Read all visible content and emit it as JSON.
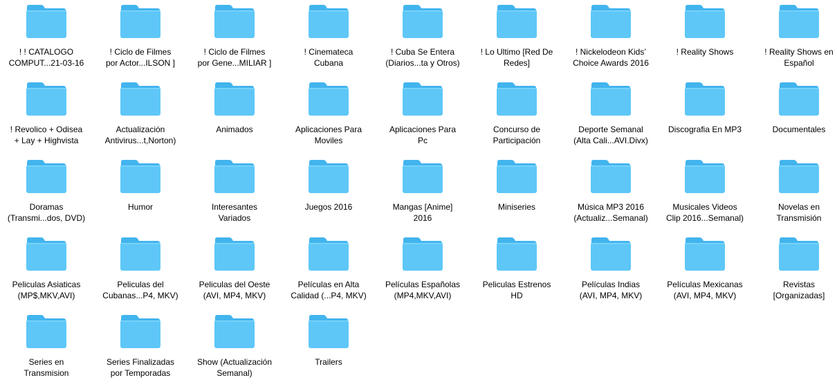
{
  "colors": {
    "folder_body": "#5ec7f7",
    "folder_back": "#42b4ee",
    "folder_highlight": "#7fd6fb",
    "label_text": "#000000",
    "background": "#ffffff"
  },
  "icon": "folder-icon",
  "folders": [
    {
      "label": "! ! CATALOGO\nCOMPUT...21-03-16"
    },
    {
      "label": "! Ciclo de Filmes\npor Actor...ILSON ]"
    },
    {
      "label": "! Ciclo de Filmes\npor Gene...MILIAR ]"
    },
    {
      "label": "! Cinemateca\nCubana"
    },
    {
      "label": "! Cuba Se Entera\n(Diarios...ta y Otros)"
    },
    {
      "label": "! Lo Ultimo [Red De\nRedes]"
    },
    {
      "label": "! Nickelodeon Kids’\nChoice Awards 2016"
    },
    {
      "label": "! Reality Shows"
    },
    {
      "label": "! Reality Shows en\nEspañol"
    },
    {
      "label": "! Revolico + Odisea\n+ Lay + Highvista"
    },
    {
      "label": "Actualización\nAntivirus...t,Norton)"
    },
    {
      "label": "Animados"
    },
    {
      "label": "Aplicaciones Para\nMoviles"
    },
    {
      "label": "Aplicaciones Para\nPc"
    },
    {
      "label": "Concurso de\nParticipación"
    },
    {
      "label": "Deporte Semanal\n(Alta Cali...AVI.Divx)"
    },
    {
      "label": "Discografia En MP3"
    },
    {
      "label": "Documentales"
    },
    {
      "label": "Doramas\n(Transmi...dos, DVD)"
    },
    {
      "label": "Humor"
    },
    {
      "label": "Interesantes\nVariados"
    },
    {
      "label": "Juegos 2016"
    },
    {
      "label": "Mangas [Anime]\n2016"
    },
    {
      "label": "Miniseries"
    },
    {
      "label": "Música MP3 2016\n(Actualiz...Semanal)"
    },
    {
      "label": "Musicales Videos\nClip 2016...Semanal)"
    },
    {
      "label": "Novelas en\nTransmisión"
    },
    {
      "label": "Peliculas Asiaticas\n(MP$,MKV,AVI)"
    },
    {
      "label": "Peliculas del\nCubanas...P4, MKV)"
    },
    {
      "label": "Peliculas del Oeste\n(AVI, MP4, MKV)"
    },
    {
      "label": "Películas en Alta\nCalidad (...P4, MKV)"
    },
    {
      "label": "Películas Españolas\n(MP4,MKV,AVI)"
    },
    {
      "label": "Peliculas Estrenos\nHD"
    },
    {
      "label": "Películas Indias\n(AVI, MP4, MKV)"
    },
    {
      "label": "Películas Mexicanas\n(AVI, MP4, MKV)"
    },
    {
      "label": "Revistas\n[Organizadas]"
    },
    {
      "label": "Series en\nTransmision"
    },
    {
      "label": "Series Finalizadas\npor Temporadas"
    },
    {
      "label": "Show (Actualización\nSemanal)"
    },
    {
      "label": "Trailers"
    }
  ]
}
